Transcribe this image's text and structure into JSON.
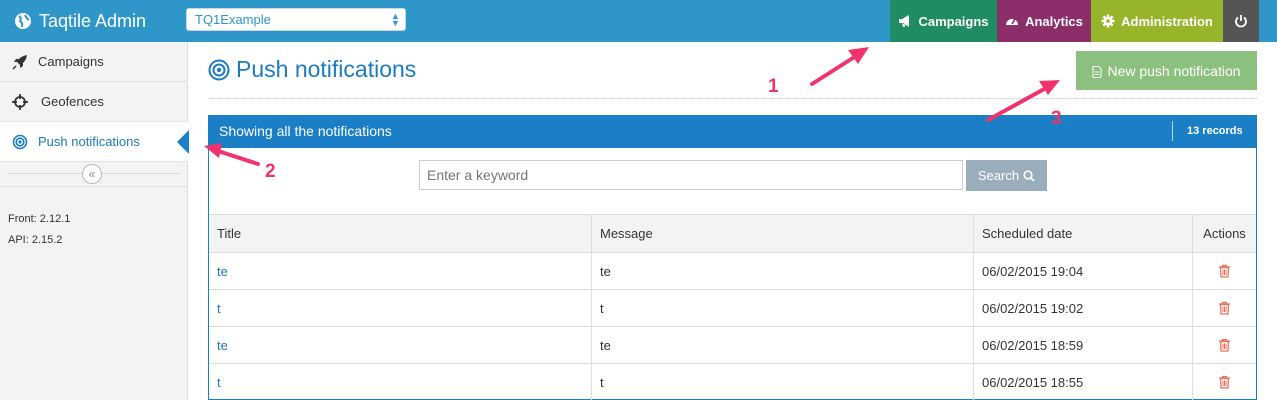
{
  "header": {
    "brand": "Taqtile Admin",
    "app_selector": {
      "value": "TQ1Example"
    },
    "nav": [
      {
        "label": "Campaigns",
        "icon": "megaphone-icon",
        "color": "#1f8c63"
      },
      {
        "label": "Analytics",
        "icon": "dashboard-icon",
        "color": "#8b2e6a"
      },
      {
        "label": "Administration",
        "icon": "gear-icon",
        "color": "#96b52a"
      },
      {
        "label": "",
        "icon": "power-icon",
        "color": "#555555"
      }
    ]
  },
  "sidebar": {
    "items": [
      {
        "label": "Campaigns",
        "icon": "rocket-icon",
        "active": false
      },
      {
        "label": "Geofences",
        "icon": "crosshair-icon",
        "active": false
      },
      {
        "label": "Push notifications",
        "icon": "target-icon",
        "active": true
      }
    ],
    "collapse_icon": "double-chevron-left-icon",
    "versions": {
      "front": "Front: 2.12.1",
      "api": "API: 2.15.2"
    }
  },
  "main": {
    "title": "Push notifications",
    "new_button": "New push notification",
    "panel": {
      "title": "Showing all the notifications",
      "records": "13 records"
    },
    "search": {
      "placeholder": "Enter a keyword",
      "button": "Search"
    },
    "table": {
      "columns": [
        "Title",
        "Message",
        "Scheduled date",
        "Actions"
      ],
      "rows": [
        {
          "title": "te",
          "message": "te",
          "date": "06/02/2015 19:04"
        },
        {
          "title": "t",
          "message": "t",
          "date": "06/02/2015 19:02"
        },
        {
          "title": "te",
          "message": "te",
          "date": "06/02/2015 18:59"
        },
        {
          "title": "t",
          "message": "t",
          "date": "06/02/2015 18:55"
        }
      ]
    }
  },
  "annotations": [
    "1",
    "2",
    "3"
  ],
  "colors": {
    "topbar": "#2e96c9",
    "accent": "#1a7fc7",
    "new_button": "#8cc07e",
    "search_button": "#9aadbd",
    "arrow": "#f0336d"
  }
}
